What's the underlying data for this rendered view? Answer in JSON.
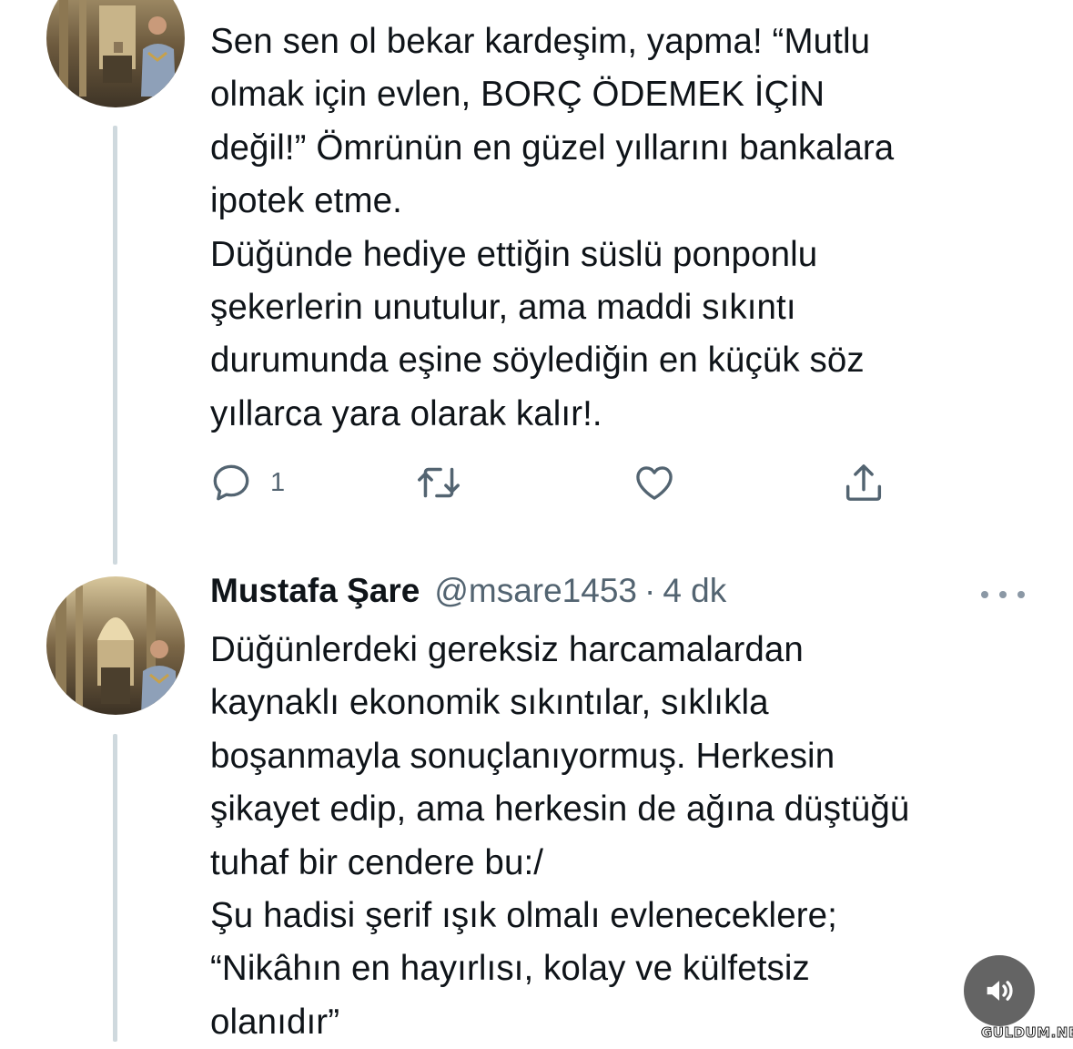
{
  "tweet1": {
    "text_lines": [
      "Sen sen ol bekar kardeşim, yapma! “Mutlu",
      "olmak için evlen, BORÇ ÖDEMEK İÇİN",
      "değil!” Ömrünün en güzel yıllarını bankalara",
      "ipotek etme.",
      "Düğünde hediye ettiğin süslü ponponlu",
      "şekerlerin unutulur, ama maddi sıkıntı",
      "durumunda eşine söylediğin en küçük söz",
      "yıllarca yara olarak kalır!."
    ],
    "actions": {
      "reply_icon": "reply-icon",
      "reply_count": "1",
      "retweet_icon": "retweet-icon",
      "like_icon": "like-icon",
      "share_icon": "share-icon"
    }
  },
  "tweet2": {
    "author_name": "Mustafa Şare",
    "author_handle": "@msare1453",
    "separator": "·",
    "time_ago": "4 dk",
    "more_icon": "more-icon",
    "text_lines": [
      "Düğünlerdeki gereksiz harcamalardan",
      "kaynaklı ekonomik sıkıntılar, sıklıkla",
      "boşanmayla sonuçlanıyormuş. Herkesin",
      "şikayet edip, ama herkesin de ağına düştüğü",
      "tuhaf bir cendere bu:/",
      "Şu hadisi şerif ışık olmalı  evleneceklere;",
      "“Nikâhın en hayırlısı, kolay ve külfetsiz",
      "olanıdır”"
    ]
  },
  "overlay": {
    "volume_icon": "volume-icon",
    "watermark": "GULDUM.NET"
  },
  "colors": {
    "text": "#0f1419",
    "secondary": "#536471",
    "thread_line": "#cfd9de"
  }
}
